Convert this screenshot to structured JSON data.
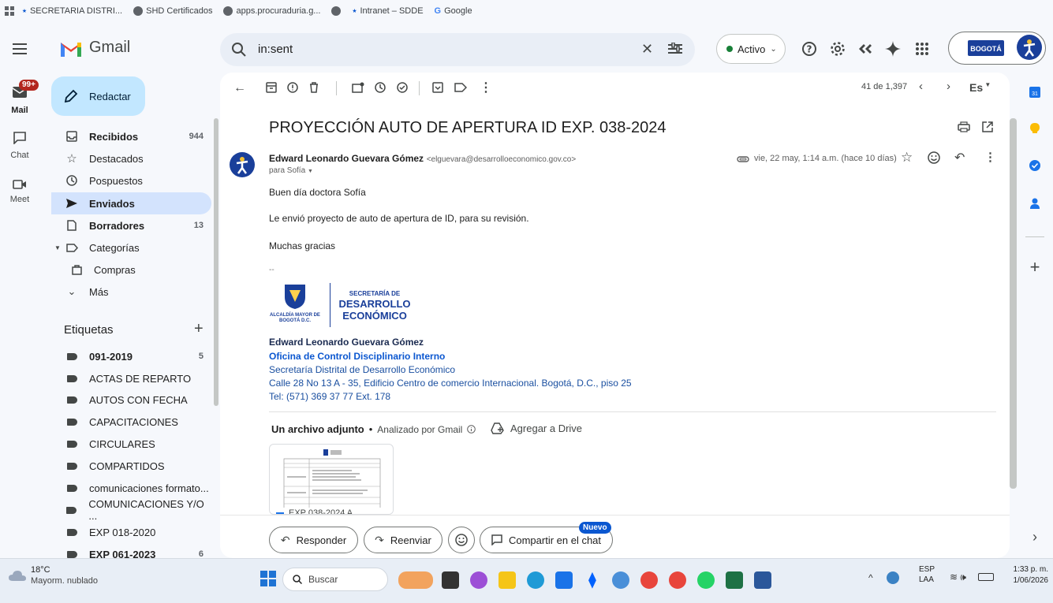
{
  "bookmarks": [
    "SECRETARIA DISTRI...",
    "SHD Certificados",
    "apps.procuraduria.g...",
    "",
    "Intranet – SDDE",
    "Google"
  ],
  "app": {
    "name": "Gmail"
  },
  "search": {
    "value": "in:sent"
  },
  "status": {
    "label": "Activo"
  },
  "rail": {
    "mail": "Mail",
    "mail_badge": "99+",
    "chat": "Chat",
    "meet": "Meet"
  },
  "compose": {
    "label": "Redactar"
  },
  "nav": [
    {
      "label": "Recibidos",
      "count": "944"
    },
    {
      "label": "Destacados",
      "count": ""
    },
    {
      "label": "Pospuestos",
      "count": ""
    },
    {
      "label": "Enviados",
      "count": ""
    },
    {
      "label": "Borradores",
      "count": "13"
    },
    {
      "label": "Categorías",
      "count": ""
    },
    {
      "label": "Compras",
      "count": ""
    },
    {
      "label": "Más",
      "count": ""
    }
  ],
  "labels_header": "Etiquetas",
  "labels": [
    {
      "label": "091-2019",
      "count": "5"
    },
    {
      "label": "ACTAS DE REPARTO",
      "count": ""
    },
    {
      "label": "AUTOS CON FECHA",
      "count": ""
    },
    {
      "label": "CAPACITACIONES",
      "count": ""
    },
    {
      "label": "CIRCULARES",
      "count": ""
    },
    {
      "label": "COMPARTIDOS",
      "count": ""
    },
    {
      "label": "comunicaciones formato...",
      "count": ""
    },
    {
      "label": "COMUNICACIONES Y/O ...",
      "count": ""
    },
    {
      "label": "EXP 018-2020",
      "count": ""
    },
    {
      "label": "EXP 061-2023",
      "count": "6"
    }
  ],
  "toolbar": {
    "pager": "41 de 1,397",
    "lang": "Es"
  },
  "email": {
    "subject": "PROYECCIÓN AUTO DE APERTURA ID EXP. 038-2024",
    "sender_name": "Edward Leonardo Guevara Gómez",
    "sender_email": "<elguevara@desarrolloeconomico.gov.co>",
    "to": "para Sofía",
    "date": "vie, 22 may, 1:14 a.m. (hace 10 días)",
    "body": [
      "Buen día doctora Sofía",
      "Le envió proyecto de auto de apertura de ID, para su revisión.",
      "Muchas gracias",
      "--"
    ],
    "logo_left": "ALCALDÍA MAYOR DE BOGOTÁ D.C.",
    "logo_right_1": "SECRETARÍA DE",
    "logo_right_2": "DESARROLLO",
    "logo_right_3": "ECONÓMICO",
    "signature": {
      "name": "Edward Leonardo Guevara Gómez",
      "office": "Oficina de Control Disciplinario Interno",
      "entity": "Secretaría Distrital de Desarrollo Económico",
      "address": "Calle 28 No 13 A - 35, Edificio Centro de comercio Internacional. Bogotá, D.C., piso 25",
      "tel": "Tel: (571) 369 37 77 Ext. 178"
    },
    "attach_title": "Un archivo adjunto",
    "attach_scan": "Analizado por Gmail",
    "attach_drive": "Agregar a Drive",
    "attach_name": "EXP 038-2024 A..."
  },
  "actions": {
    "reply": "Responder",
    "forward": "Reenviar",
    "share": "Compartir en el chat",
    "new_badge": "Nuevo"
  },
  "taskbar": {
    "temp": "18°C",
    "weather": "Mayorm. nublado",
    "search": "Buscar",
    "lang1": "ESP",
    "lang2": "LAA",
    "time": "1:33 p. m.",
    "date": "1/06/2026"
  },
  "colors": {
    "accent": "#0b57d0",
    "active_nav": "#d3e3fd",
    "compose": "#c2e7ff",
    "badge": "#b3261e"
  }
}
